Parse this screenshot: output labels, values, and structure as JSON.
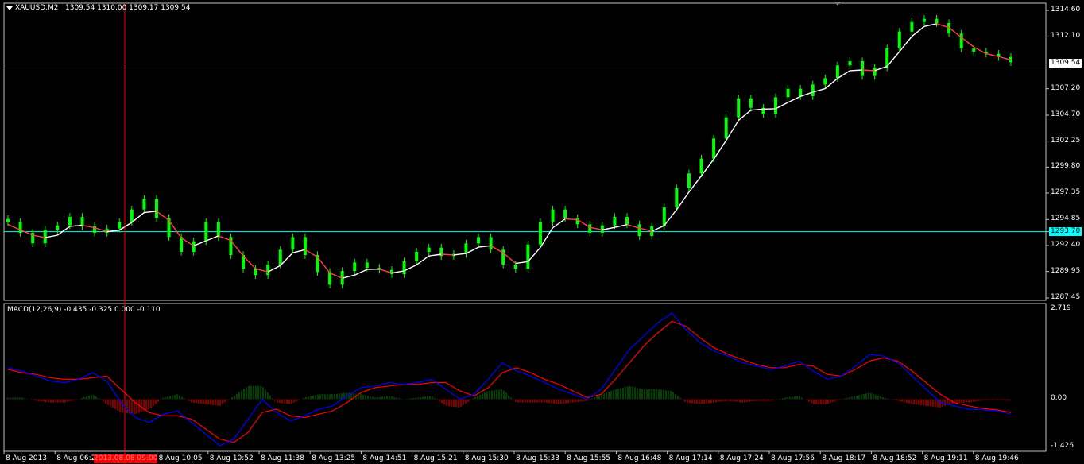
{
  "chart_header": {
    "symbol": "XAUUSD,M2",
    "ohlc": "1309.54 1310.00 1309.17 1309.54"
  },
  "macd_header": {
    "text": "MACD(12,26,9) -0.435 -0.325 0.000 -0.110"
  },
  "price_axis": {
    "ticks": [
      "1314.60",
      "1312.10",
      "1309.54",
      "1307.20",
      "1304.70",
      "1302.25",
      "1299.80",
      "1297.35",
      "1294.85",
      "1293.70",
      "1292.40",
      "1289.95",
      "1287.45"
    ],
    "current_price": "1309.54",
    "hline_price": "1293.70"
  },
  "macd_axis": {
    "ticks": [
      "2.719",
      "0.00",
      "-1.426"
    ]
  },
  "time_axis": {
    "labels": [
      "8 Aug 2013",
      "8 Aug 06:25",
      "2013.08.08 09:00",
      "8 Aug 10:05",
      "8 Aug 10:52",
      "8 Aug 11:38",
      "8 Aug 13:25",
      "8 Aug 14:51",
      "8 Aug 15:21",
      "8 Aug 15:30",
      "8 Aug 15:33",
      "8 Aug 15:55",
      "8 Aug 16:48",
      "8 Aug 17:14",
      "8 Aug 17:24",
      "8 Aug 17:56",
      "8 Aug 18:17",
      "8 Aug 18:52",
      "8 Aug 19:11",
      "8 Aug 19:46"
    ],
    "highlighted": "2013.08.08 09:00"
  },
  "colors": {
    "background": "#000000",
    "grid_border": "#c0c0c0",
    "bull_bar": "#00ff00",
    "ma_down": "#ff4040",
    "ma_up": "#ffffff",
    "hline_cyan": "#00ffff",
    "crosshair": "#ff0000",
    "macd_main": "#0000ff",
    "macd_signal": "#ff0000",
    "hist_pos": "#008000",
    "hist_neg": "#ff0000"
  },
  "chart_data": [
    {
      "type": "line",
      "title": "XAUUSD,M2",
      "price_range": [
        1287.45,
        1314.6
      ],
      "closes": [
        1294.6,
        1293.6,
        1292.6,
        1293.9,
        1294.3,
        1295.1,
        1294.2,
        1293.6,
        1294.0,
        1294.6,
        1295.8,
        1296.8,
        1295.0,
        1293.2,
        1291.8,
        1292.8,
        1294.6,
        1293.2,
        1291.5,
        1290.2,
        1289.6,
        1290.6,
        1292.0,
        1293.2,
        1291.5,
        1289.9,
        1288.7,
        1290.0,
        1290.8,
        1290.3,
        1290.1,
        1289.7,
        1290.9,
        1291.8,
        1292.2,
        1291.4,
        1291.6,
        1292.6,
        1293.2,
        1292.0,
        1290.6,
        1290.2,
        1292.5,
        1294.6,
        1295.8,
        1295.0,
        1294.4,
        1293.6,
        1294.3,
        1295.1,
        1294.4,
        1293.3,
        1294.2,
        1296.0,
        1297.8,
        1299.2,
        1300.6,
        1302.5,
        1304.5,
        1306.3,
        1305.4,
        1304.8,
        1306.4,
        1307.2,
        1306.5,
        1307.6,
        1308.2,
        1309.4,
        1309.8,
        1308.4,
        1309.2,
        1311.0,
        1312.6,
        1313.5,
        1313.8,
        1313.4,
        1312.4,
        1311.0,
        1310.7,
        1310.5,
        1310.2,
        1309.7
      ]
    },
    {
      "type": "line",
      "title": "MACD(12,26,9)",
      "range": [
        -1.426,
        2.719
      ],
      "main": [
        0.95,
        0.85,
        0.7,
        0.55,
        0.5,
        0.6,
        0.8,
        0.55,
        -0.1,
        -0.55,
        -0.7,
        -0.45,
        -0.35,
        -0.7,
        -1.05,
        -1.4,
        -1.2,
        -0.6,
        0.0,
        -0.4,
        -0.65,
        -0.5,
        -0.3,
        -0.2,
        0.1,
        0.35,
        0.4,
        0.5,
        0.45,
        0.5,
        0.6,
        0.3,
        0.0,
        0.15,
        0.6,
        1.1,
        0.85,
        0.7,
        0.5,
        0.3,
        0.15,
        0.0,
        0.3,
        0.9,
        1.5,
        1.9,
        2.3,
        2.6,
        2.1,
        1.7,
        1.45,
        1.3,
        1.1,
        1.0,
        0.9,
        1.0,
        1.15,
        0.85,
        0.6,
        0.7,
        1.0,
        1.35,
        1.3,
        1.1,
        0.7,
        0.3,
        -0.1,
        -0.2,
        -0.3,
        -0.32,
        -0.35,
        -0.45
      ],
      "signal": [
        0.9,
        0.8,
        0.75,
        0.65,
        0.6,
        0.6,
        0.65,
        0.7,
        0.3,
        -0.1,
        -0.4,
        -0.5,
        -0.5,
        -0.6,
        -0.9,
        -1.2,
        -1.3,
        -1.0,
        -0.4,
        -0.3,
        -0.5,
        -0.55,
        -0.45,
        -0.35,
        -0.1,
        0.2,
        0.35,
        0.4,
        0.45,
        0.45,
        0.5,
        0.5,
        0.25,
        0.1,
        0.35,
        0.8,
        0.95,
        0.8,
        0.6,
        0.45,
        0.25,
        0.05,
        0.15,
        0.6,
        1.1,
        1.6,
        2.0,
        2.35,
        2.2,
        1.85,
        1.55,
        1.35,
        1.2,
        1.05,
        0.95,
        0.95,
        1.05,
        1.0,
        0.75,
        0.7,
        0.9,
        1.15,
        1.25,
        1.15,
        0.85,
        0.5,
        0.15,
        -0.1,
        -0.2,
        -0.28,
        -0.32,
        -0.4
      ],
      "histogram": [
        0.05,
        0.05,
        -0.05,
        -0.1,
        -0.1,
        0.0,
        0.15,
        -0.15,
        -0.4,
        -0.45,
        -0.3,
        0.05,
        0.15,
        -0.1,
        -0.15,
        -0.2,
        0.1,
        0.4,
        0.4,
        -0.1,
        -0.15,
        0.05,
        0.15,
        0.15,
        0.2,
        0.15,
        0.05,
        0.1,
        0.0,
        0.05,
        0.1,
        -0.2,
        -0.25,
        0.05,
        0.25,
        0.3,
        -0.1,
        -0.1,
        -0.1,
        -0.15,
        -0.1,
        -0.05,
        0.15,
        0.3,
        0.4,
        0.3,
        0.3,
        0.25,
        -0.1,
        -0.15,
        -0.1,
        -0.05,
        -0.1,
        -0.05,
        -0.05,
        0.05,
        0.1,
        -0.15,
        -0.15,
        0.0,
        0.1,
        0.2,
        0.05,
        -0.05,
        -0.15,
        -0.2,
        -0.25,
        -0.1,
        -0.1,
        -0.04,
        -0.03,
        -0.05
      ]
    }
  ]
}
